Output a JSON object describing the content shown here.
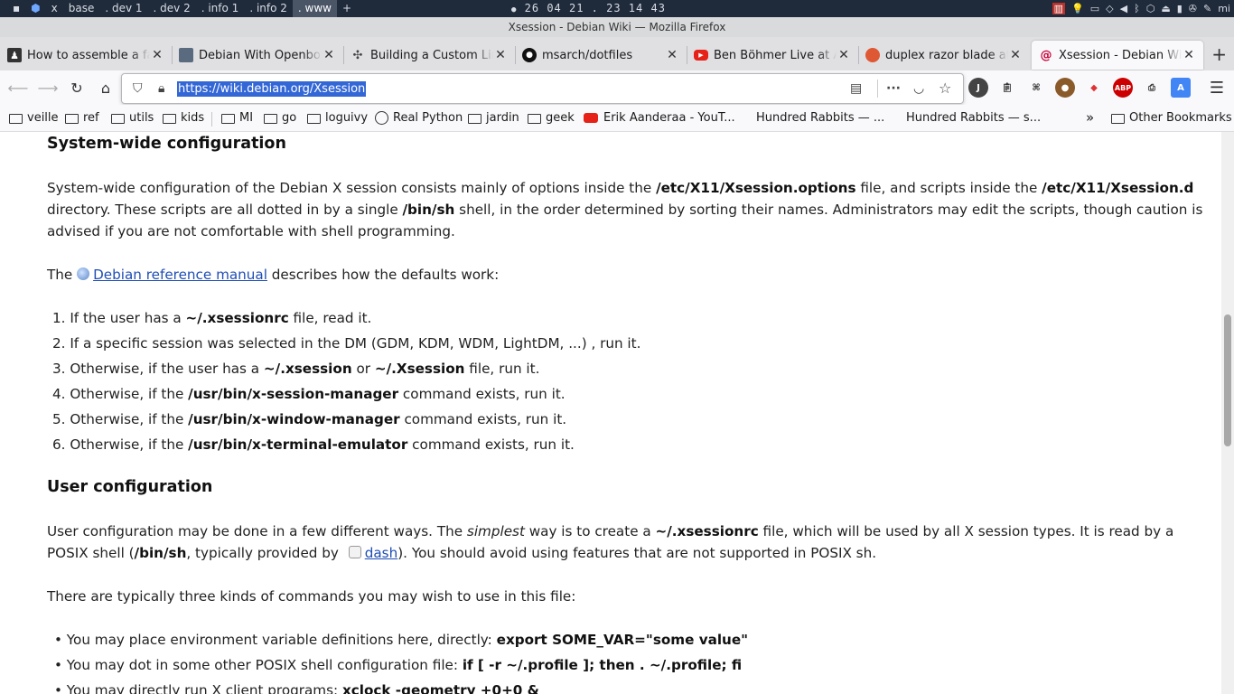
{
  "topbar": {
    "workspaces": [
      "x",
      "base",
      ". dev 1",
      ". dev 2",
      ". info 1",
      ". info 2",
      ". www",
      "+"
    ],
    "active_workspace": ". www",
    "clock": "26 04 21 . 23 14 43",
    "user": "mi"
  },
  "window": {
    "title": "Xsession - Debian Wiki — Mozilla Firefox"
  },
  "tabs": [
    {
      "label": "How to assemble a fat",
      "selected": false
    },
    {
      "label": "Debian With Openbox",
      "selected": false
    },
    {
      "label": "Building a Custom Lin",
      "selected": false
    },
    {
      "label": "msarch/dotfiles",
      "selected": false
    },
    {
      "label": "Ben Böhmer Live at An",
      "selected": false
    },
    {
      "label": "duplex razor blade at",
      "selected": false
    },
    {
      "label": "Xsession - Debian Wik",
      "selected": true
    }
  ],
  "navbar": {
    "url": "https://wiki.debian.org/Xsession"
  },
  "bookmarks": {
    "items": [
      "veille",
      "ref",
      "utils",
      "kids",
      "MI",
      "go",
      "loguivy",
      "Real Python",
      "jardin",
      "geek",
      "Erik Aanderaa - YouT...",
      "Hundred Rabbits — ...",
      "Hundred Rabbits — s..."
    ],
    "other": "Other Bookmarks"
  },
  "article": {
    "h_system": "System-wide configuration",
    "p1": {
      "t1": "System-wide configuration of the Debian X session consists mainly of options inside the ",
      "b1": "/etc/X11/Xsession.options",
      "t2": " file, and scripts inside the ",
      "b2": "/etc/X11/Xsession.d",
      "t3": " directory. These scripts are all dotted in by a single ",
      "b3": "/bin/sh",
      "t4": " shell, in the order determined by sorting their names. Administrators may edit the scripts, though caution is advised if you are not comfortable with shell programming."
    },
    "p2": {
      "t1": "The ",
      "link": "Debian reference manual",
      "t2": " describes how the defaults work:"
    },
    "ol": [
      {
        "n": "1.",
        "t1": "If the user has a ",
        "b1": "~/.xsessionrc",
        "t2": " file, read it."
      },
      {
        "n": "2.",
        "t1": "If a specific session was selected in the DM (GDM, KDM, WDM, LightDM, ...) , run it."
      },
      {
        "n": "3.",
        "t1": "Otherwise, if the user has a ",
        "b1": "~/.xsession",
        "t2": " or ",
        "b2": "~/.Xsession",
        "t3": " file, run it."
      },
      {
        "n": "4.",
        "t1": "Otherwise, if the ",
        "b1": "/usr/bin/x-session-manager",
        "t2": " command exists, run it."
      },
      {
        "n": "5.",
        "t1": "Otherwise, if the ",
        "b1": "/usr/bin/x-window-manager",
        "t2": " command exists, run it."
      },
      {
        "n": "6.",
        "t1": "Otherwise, if the ",
        "b1": "/usr/bin/x-terminal-emulator",
        "t2": " command exists, run it."
      }
    ],
    "h_user": "User configuration",
    "p3": {
      "t1": "User configuration may be done in a few different ways. The ",
      "i1": "simplest",
      "t2": " way is to create a ",
      "b1": "~/.xsessionrc",
      "t3": " file, which will be used by all X session types. It is read by a POSIX shell (",
      "b2": "/bin/sh",
      "t4": ", typically provided by ",
      "link": "dash",
      "t5": "). You should avoid using features that are not supported in POSIX sh."
    },
    "p4": "There are typically three kinds of commands you may wish to use in this file:",
    "ul": [
      {
        "t1": "You may place environment variable definitions here, directly: ",
        "b1": "export SOME_VAR=\"some value\""
      },
      {
        "t1": "You may dot in some other POSIX shell configuration file: ",
        "b1": "if [ -r ~/.profile ]; then . ~/.profile; fi"
      },
      {
        "t1": "You may directly run X client programs: ",
        "b1": "xclock -geometry +0+0 &"
      }
    ]
  },
  "colors": {
    "accent": "#3367d6",
    "link": "#1f4eb4",
    "topbar": "#1f2a3a"
  }
}
